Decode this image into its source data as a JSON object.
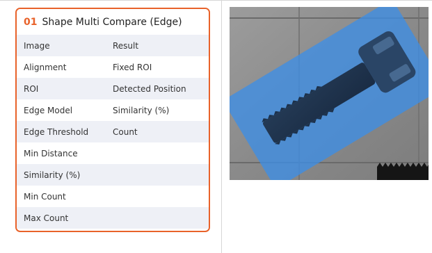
{
  "card": {
    "index": "01",
    "title": "Shape Multi Compare (Edge)",
    "rows": [
      {
        "left": "Image",
        "right": "Result"
      },
      {
        "left": "Alignment",
        "right": "Fixed ROI"
      },
      {
        "left": "ROI",
        "right": "Detected Position"
      },
      {
        "left": "Edge Model",
        "right": "Similarity (%)"
      },
      {
        "left": "Edge Threshold",
        "right": "Count"
      },
      {
        "left": "Min Distance",
        "right": ""
      },
      {
        "left": "Similarity (%)",
        "right": ""
      },
      {
        "left": "Min Count",
        "right": ""
      },
      {
        "left": "Max Count",
        "right": ""
      }
    ]
  },
  "colors": {
    "accent": "#e8622a",
    "row_shade": "#eef0f6",
    "roi_fill": "#3d8ee6"
  },
  "viewer": {
    "icon": "bolt-inspection-image"
  }
}
